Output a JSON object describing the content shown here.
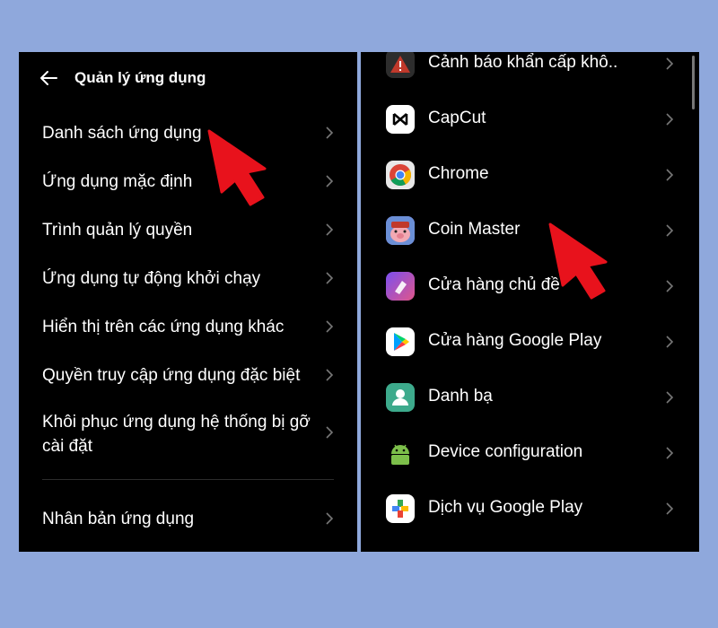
{
  "left": {
    "title": "Quản lý ứng dụng",
    "items": [
      {
        "label": "Danh sách ứng dụng"
      },
      {
        "label": "Ứng dụng mặc định"
      },
      {
        "label": "Trình quản lý quyền"
      },
      {
        "label": "Ứng dụng tự động khởi chạy"
      },
      {
        "label": "Hiển thị trên các ứng dụng khác"
      },
      {
        "label": "Quyền truy cập ứng dụng đặc biệt"
      },
      {
        "label": "Khôi phục ứng dụng hệ thống bị gỡ cài đặt"
      },
      {
        "label": "Nhân bản ứng dụng"
      }
    ]
  },
  "right": {
    "apps": [
      {
        "name": "Cảnh báo khẩn cấp khô..",
        "icon": "emergency-alert-icon"
      },
      {
        "name": "CapCut",
        "icon": "capcut-icon"
      },
      {
        "name": "Chrome",
        "icon": "chrome-icon"
      },
      {
        "name": "Coin Master",
        "icon": "coin-master-icon"
      },
      {
        "name": "Cửa hàng chủ đề",
        "icon": "theme-store-icon"
      },
      {
        "name": "Cửa hàng Google Play",
        "icon": "google-play-store-icon"
      },
      {
        "name": "Danh bạ",
        "icon": "contacts-icon"
      },
      {
        "name": "Device configuration",
        "icon": "android-icon"
      },
      {
        "name": "Dịch vụ Google Play",
        "icon": "google-play-services-icon"
      }
    ]
  },
  "colors": {
    "page_background": "#8fa8dc",
    "panel_background": "#000000",
    "pointer_arrow": "#e8121c"
  }
}
